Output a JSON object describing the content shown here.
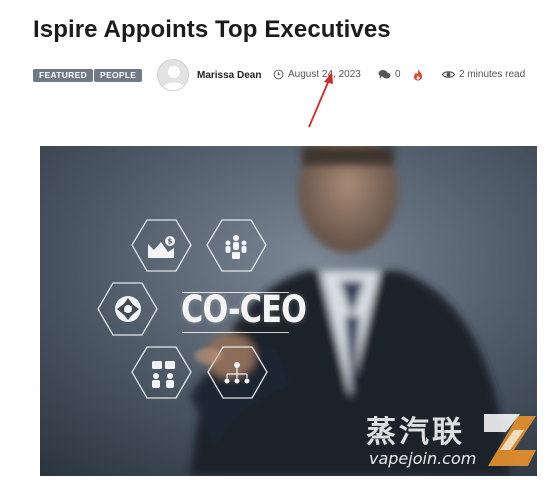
{
  "article": {
    "title": "Ispire Appoints Top Executives"
  },
  "meta": {
    "tags": [
      "FEATURED",
      "PEOPLE"
    ],
    "author": "Marissa Dean",
    "date": "August 24, 2023",
    "comments": "0",
    "read_time": "2 minutes read",
    "icons": [
      "avatar",
      "clock-icon",
      "comments-icon",
      "flame-icon",
      "eye-icon"
    ],
    "colors": {
      "tag_bg": "#707a86",
      "flame": "#e8452e"
    }
  },
  "hero": {
    "headline": "CO-CEO",
    "icons": [
      "finance-icon",
      "team-icon",
      "aperture-icon",
      "meeting-icon",
      "org-chart-icon"
    ],
    "watermark_cn": "蒸汽联",
    "watermark_url": "vapejoin.com"
  }
}
